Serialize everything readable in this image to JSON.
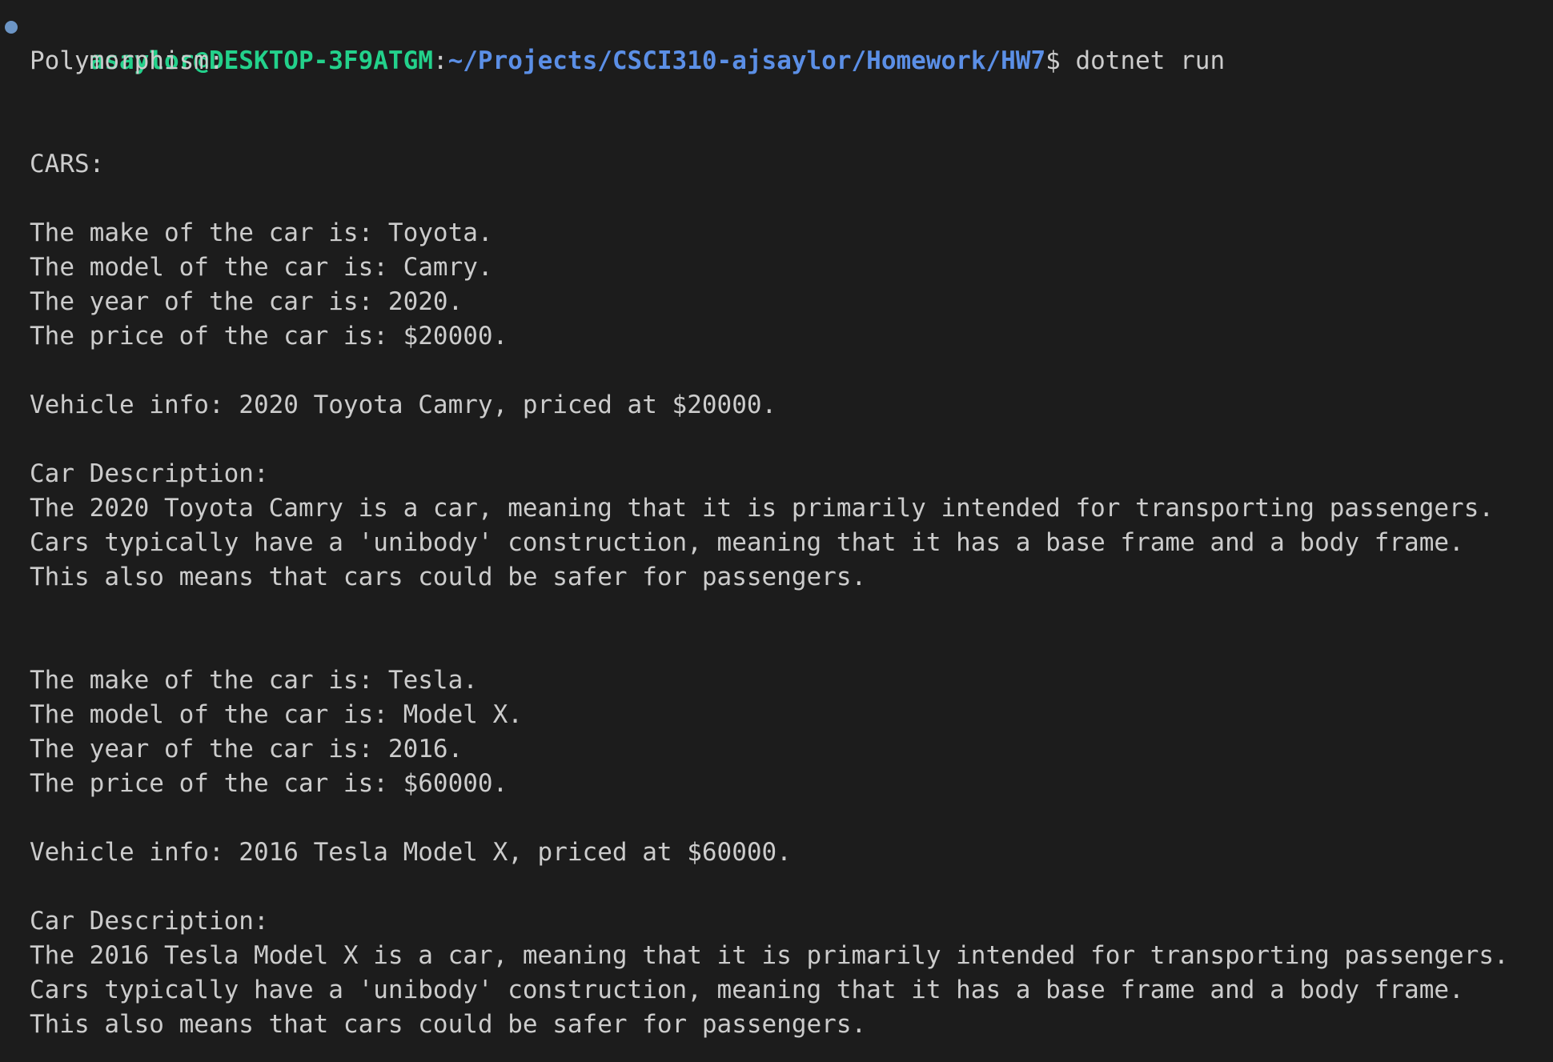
{
  "prompt": {
    "user_host": "asaylor@DESKTOP-3F9ATGM",
    "separator": ":",
    "path": "~/Projects/CSCI310-ajsaylor/Homework/HW7",
    "dollar": "$",
    "command": " dotnet run"
  },
  "output": {
    "header": "Polymorphism:",
    "section": "CARS:",
    "cars": [
      {
        "make_line": "The make of the car is: Toyota.",
        "model_line": "The model of the car is: Camry.",
        "year_line": "The year of the car is: 2020.",
        "price_line": "The price of the car is: $20000.",
        "vehicle_info": "Vehicle info: 2020 Toyota Camry, priced at $20000.",
        "desc_title": "Car Description:",
        "desc_1": "The 2020 Toyota Camry is a car, meaning that it is primarily intended for transporting passengers.",
        "desc_2": "Cars typically have a 'unibody' construction, meaning that it has a base frame and a body frame.",
        "desc_3": "This also means that cars could be safer for passengers."
      },
      {
        "make_line": "The make of the car is: Tesla.",
        "model_line": "The model of the car is: Model X.",
        "year_line": "The year of the car is: 2016.",
        "price_line": "The price of the car is: $60000.",
        "vehicle_info": "Vehicle info: 2016 Tesla Model X, priced at $60000.",
        "desc_title": "Car Description:",
        "desc_1": "The 2016 Tesla Model X is a car, meaning that it is primarily intended for transporting passengers.",
        "desc_2": "Cars typically have a 'unibody' construction, meaning that it has a base frame and a body frame.",
        "desc_3": "This also means that cars could be safer for passengers."
      }
    ]
  },
  "colors": {
    "background": "#1c1c1c",
    "text": "#cccccc",
    "user_host": "#23d18b",
    "path": "#5b8fe6",
    "status_dot": "#6c95c5"
  }
}
